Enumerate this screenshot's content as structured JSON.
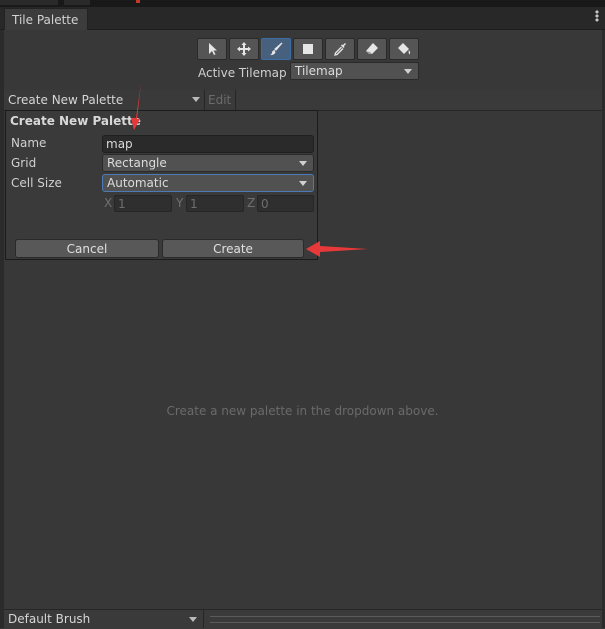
{
  "window": {
    "tab_title": "Tile Palette"
  },
  "toolbar": {
    "tools": [
      {
        "name": "select-tool",
        "icon": "cursor-icon",
        "active": false
      },
      {
        "name": "move-tool",
        "icon": "move-arrows-icon",
        "active": false
      },
      {
        "name": "paint-tool",
        "icon": "paint-brush-icon",
        "active": true
      },
      {
        "name": "box-fill-tool",
        "icon": "square-icon",
        "active": false
      },
      {
        "name": "picker-tool",
        "icon": "eyedropper-icon",
        "active": false
      },
      {
        "name": "erase-tool",
        "icon": "eraser-icon",
        "active": false
      },
      {
        "name": "fill-tool",
        "icon": "paint-bucket-icon",
        "active": false
      }
    ],
    "active_tilemap_label": "Active Tilemap",
    "active_tilemap_value": "Tilemap"
  },
  "palette_bar": {
    "palette_dropdown": "Create New Palette",
    "edit_label": "Edit"
  },
  "popup": {
    "title": "Create New Palette",
    "name_label": "Name",
    "name_value": "map",
    "grid_label": "Grid",
    "grid_value": "Rectangle",
    "cell_size_label": "Cell Size",
    "cell_size_value": "Automatic",
    "x_label": "X",
    "x_value": "1",
    "y_label": "Y",
    "y_value": "1",
    "z_label": "Z",
    "z_value": "0",
    "cancel_label": "Cancel",
    "create_label": "Create"
  },
  "main": {
    "empty_message": "Create a new palette in the dropdown above."
  },
  "bottom_bar": {
    "brush_dropdown": "Default Brush"
  },
  "colors": {
    "background": "#383838",
    "active_tool": "#46607e",
    "annotation_arrow": "#e8393a"
  }
}
